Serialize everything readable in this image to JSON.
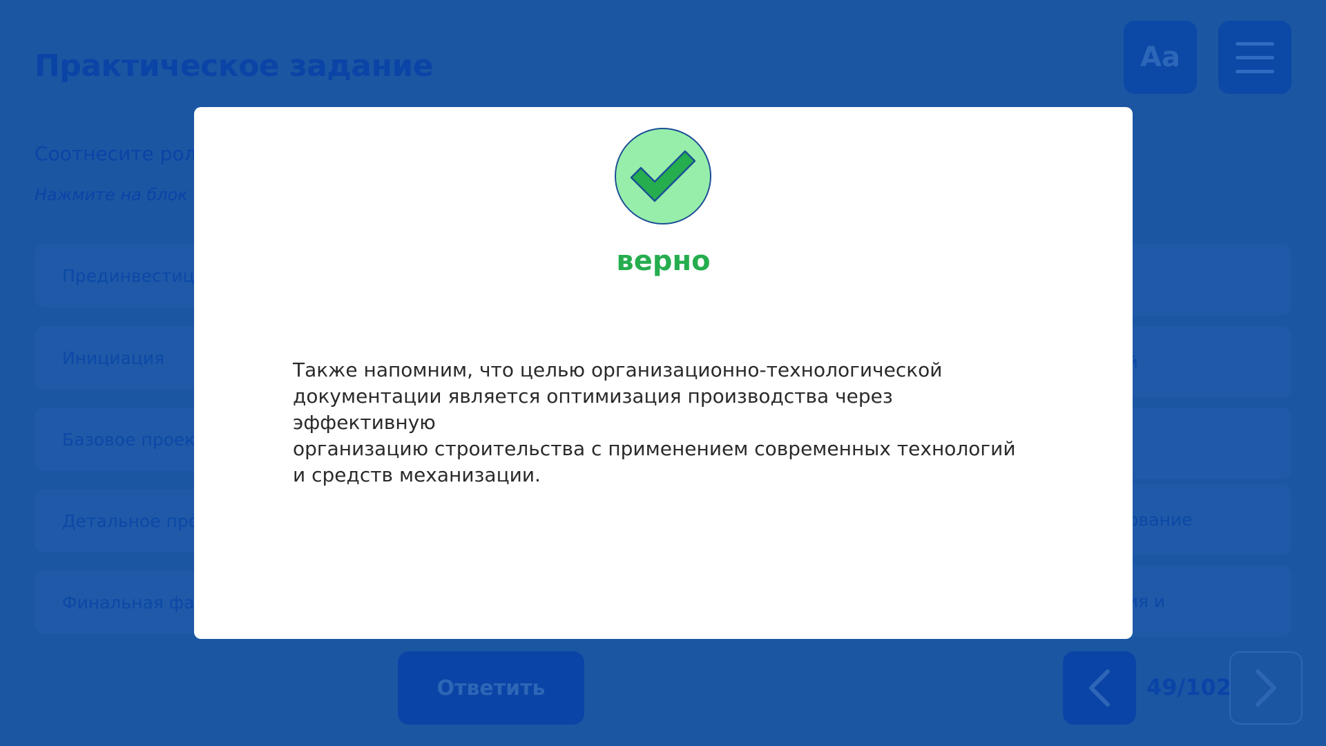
{
  "header": {
    "title": "Практическое задание",
    "font_button_label": "Aa"
  },
  "task": {
    "instruction": "Соотнесите роли",
    "hint": "Нажмите на блок и"
  },
  "left_items": [
    {
      "label": "Прединвестици"
    },
    {
      "label": "Инициация"
    },
    {
      "label": "Базовое проект"
    },
    {
      "label": "Детальное прое"
    },
    {
      "label": "Финальная фаз"
    }
  ],
  "right_items": [
    {
      "label": ""
    },
    {
      "label": "етной"
    },
    {
      "label": ""
    },
    {
      "label": "орудование"
    },
    {
      "label": "ования и"
    }
  ],
  "footer": {
    "answer_label": "Ответить",
    "page_counter": "49/102"
  },
  "modal": {
    "result": "верно",
    "text": "Также напомним, что целью организационно-технологической\nдокументации является оптимизация производства через эффективную\nорганизацию строительства с применением современных технологий\nи средств механизации.",
    "icon": "check-icon"
  },
  "colors": {
    "background": "#1b56a3",
    "success_green": "#25ad4e",
    "check_fill": "#97eeaa",
    "modal_bg": "#ffffff"
  }
}
